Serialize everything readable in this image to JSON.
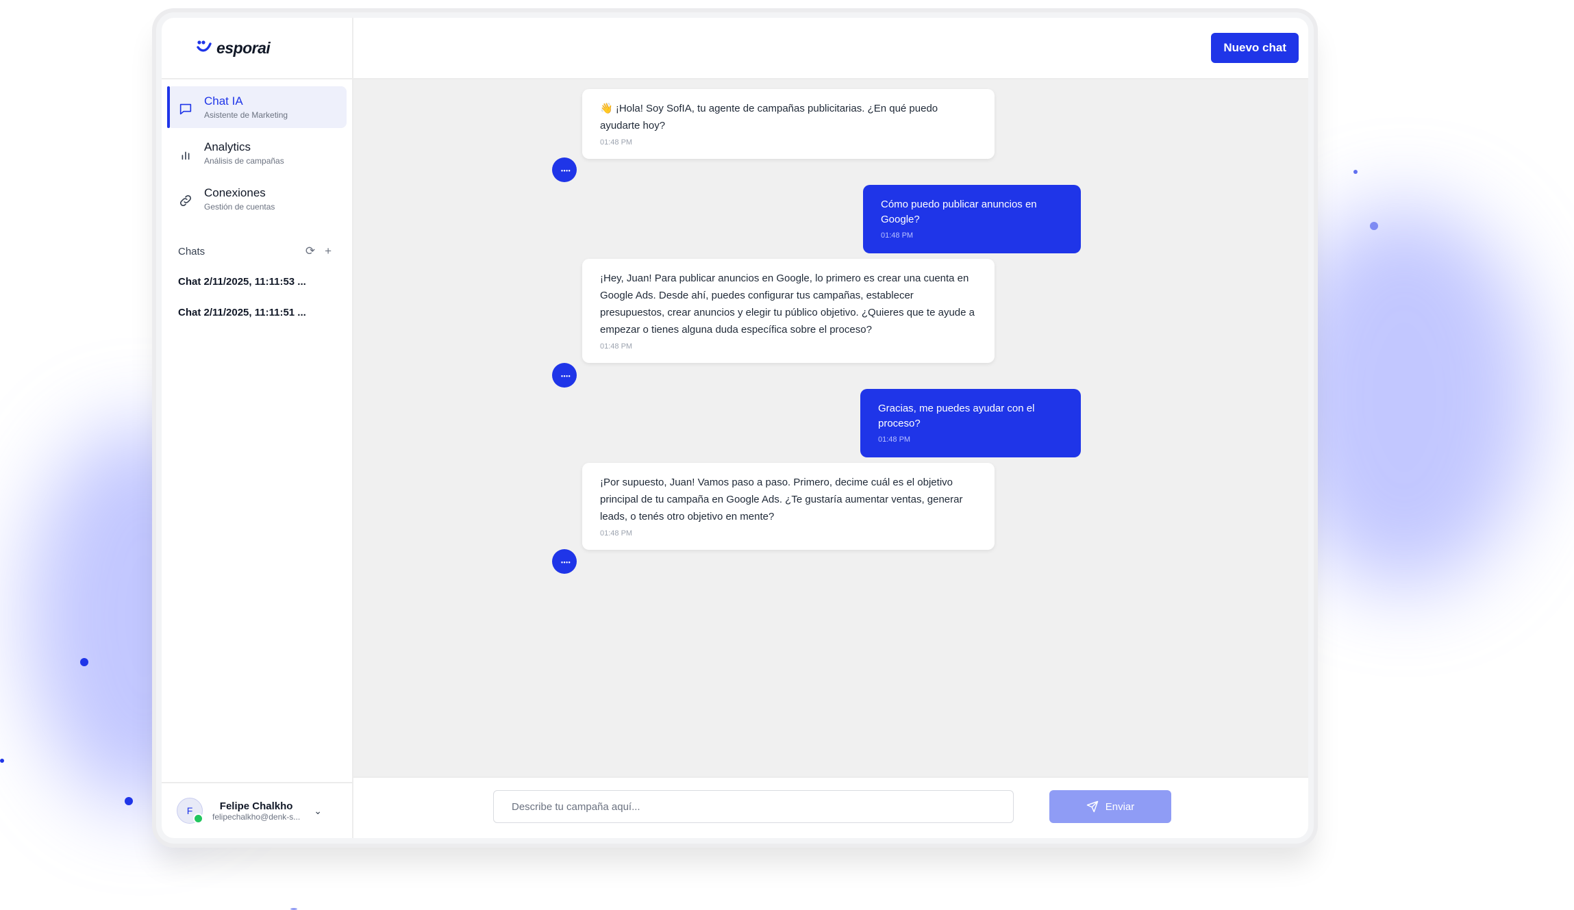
{
  "brand": {
    "name": "esporai",
    "accent": "#1f35e8"
  },
  "sidebar": {
    "nav": [
      {
        "title": "Chat IA",
        "subtitle": "Asistente de Marketing",
        "icon": "chat-bubble-icon",
        "active": true
      },
      {
        "title": "Analytics",
        "subtitle": "Análisis de campañas",
        "icon": "bar-chart-icon",
        "active": false
      },
      {
        "title": "Conexiones",
        "subtitle": "Gestión de cuentas",
        "icon": "link-icon",
        "active": false
      }
    ],
    "chats_title": "Chats",
    "chats": [
      "Chat 2/11/2025, 11:11:53 ...",
      "Chat 2/11/2025, 11:11:51 ..."
    ],
    "user": {
      "initial": "F",
      "name": "Felipe Chalkho",
      "email": "felipechalkho@denk-s..."
    }
  },
  "topbar": {
    "new_chat_label": "Nuevo chat"
  },
  "messages": [
    {
      "from": "bot",
      "text": "👋 ¡Hola! Soy SofIA, tu agente de campañas publicitarias. ¿En qué puedo ayudarte hoy?",
      "time": "01:48 PM"
    },
    {
      "from": "user",
      "text": "Cómo puedo publicar anuncios en Google?",
      "time": "01:48 PM"
    },
    {
      "from": "bot",
      "text": "¡Hey, Juan! Para publicar anuncios en Google, lo primero es crear una cuenta en Google Ads. Desde ahí, puedes configurar tus campañas, establecer presupuestos, crear anuncios y elegir tu público objetivo. ¿Quieres que te ayude a empezar o tienes alguna duda específica sobre el proceso?",
      "time": "01:48 PM"
    },
    {
      "from": "user",
      "text": "Gracias, me puedes ayudar con el proceso?",
      "time": "01:48 PM"
    },
    {
      "from": "bot",
      "text": "¡Por supuesto, Juan! Vamos paso a paso. Primero, decime cuál es el objetivo principal de tu campaña en Google Ads. ¿Te gustaría aumentar ventas, generar leads, o tenés otro objetivo en mente?",
      "time": "01:48 PM"
    }
  ],
  "composer": {
    "placeholder": "Describe tu campaña aquí...",
    "send_label": "Enviar"
  }
}
